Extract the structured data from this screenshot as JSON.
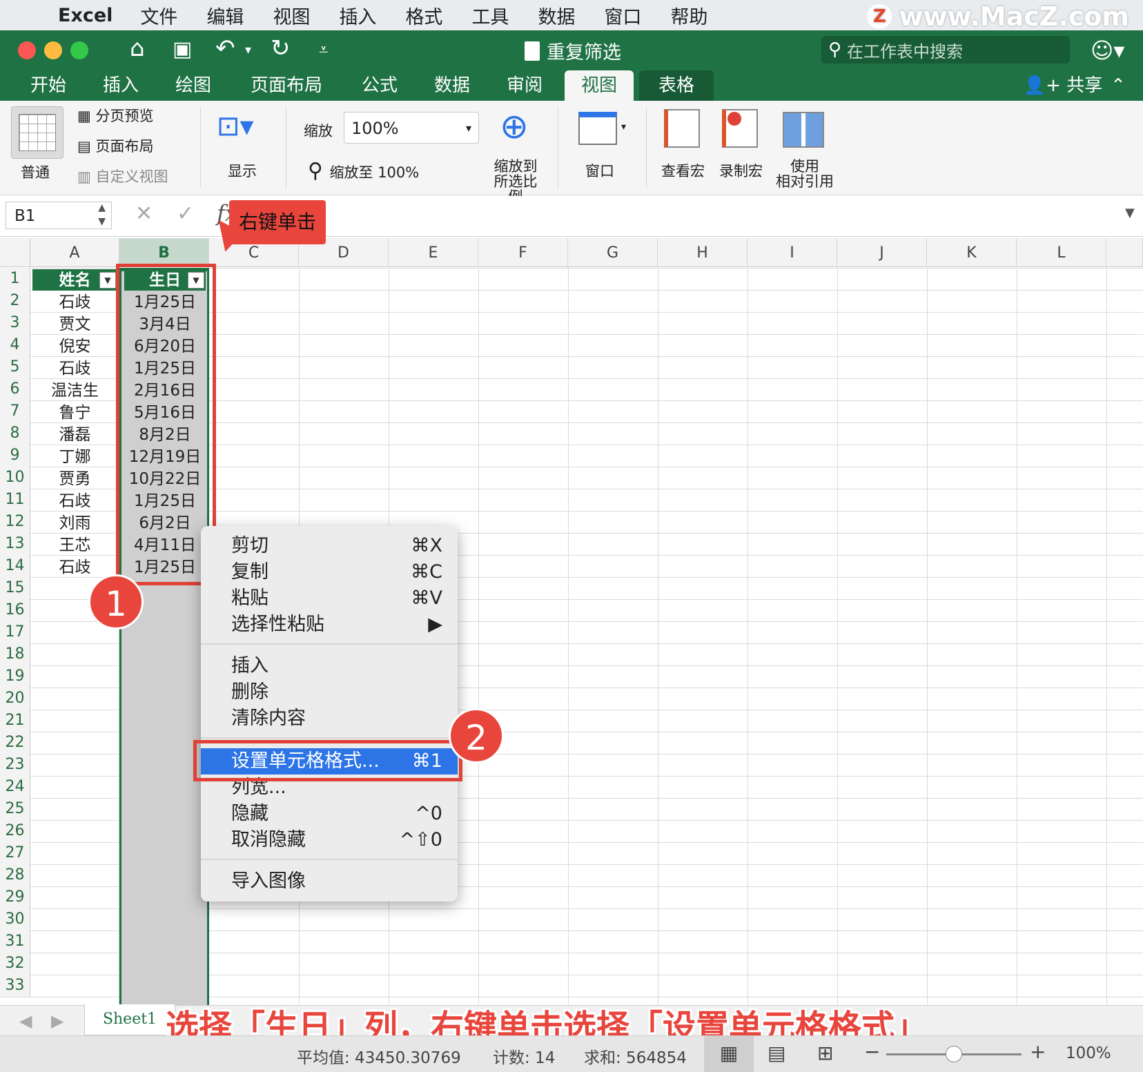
{
  "menubar": {
    "app": "Excel",
    "items": [
      "文件",
      "编辑",
      "视图",
      "插入",
      "格式",
      "工具",
      "数据",
      "窗口",
      "帮助"
    ]
  },
  "watermark": "www.MacZ.com",
  "title": "重复筛选",
  "search_placeholder": "在工作表中搜索",
  "tabs": [
    "开始",
    "插入",
    "绘图",
    "页面布局",
    "公式",
    "数据",
    "审阅",
    "视图",
    "表格"
  ],
  "active_tab": "视图",
  "share_label": "共享",
  "ribbon": {
    "normal": "普通",
    "page_break": "分页预览",
    "page_layout": "页面布局",
    "custom_view": "自定义视图",
    "show": "显示",
    "zoom_label": "缩放",
    "zoom_value": "100%",
    "zoom_100": "缩放至 100%",
    "zoom_sel_1": "缩放到",
    "zoom_sel_2": "所选比例",
    "window": "窗口",
    "view_macro": "查看宏",
    "record_macro": "录制宏",
    "relative_1": "使用",
    "relative_2": "相对引用"
  },
  "formula_bar": {
    "name_box": "B1",
    "fx": "fx"
  },
  "callout_text": "右键单击",
  "columns": [
    "A",
    "B",
    "C",
    "D",
    "E",
    "F",
    "G",
    "H",
    "I",
    "J",
    "K",
    "L"
  ],
  "rows": [
    "1",
    "2",
    "3",
    "4",
    "5",
    "6",
    "7",
    "8",
    "9",
    "10",
    "11",
    "12",
    "13",
    "14",
    "15",
    "16",
    "17",
    "18",
    "19",
    "20",
    "21",
    "22",
    "23",
    "24",
    "25",
    "26",
    "27",
    "28",
    "29",
    "30",
    "31",
    "32",
    "33"
  ],
  "table": {
    "headers": [
      "姓名",
      "生日"
    ],
    "rows": [
      [
        "石歧",
        "1月25日"
      ],
      [
        "贾文",
        "3月4日"
      ],
      [
        "倪安",
        "6月20日"
      ],
      [
        "石歧",
        "1月25日"
      ],
      [
        "温洁生",
        "2月16日"
      ],
      [
        "鲁宁",
        "5月16日"
      ],
      [
        "潘磊",
        "8月2日"
      ],
      [
        "丁娜",
        "12月19日"
      ],
      [
        "贾勇",
        "10月22日"
      ],
      [
        "石歧",
        "1月25日"
      ],
      [
        "刘雨",
        "6月2日"
      ],
      [
        "王芯",
        "4月11日"
      ],
      [
        "石歧",
        "1月25日"
      ]
    ]
  },
  "context_menu": [
    {
      "label": "剪切",
      "shortcut": "⌘X"
    },
    {
      "label": "复制",
      "shortcut": "⌘C"
    },
    {
      "label": "粘贴",
      "shortcut": "⌘V"
    },
    {
      "label": "选择性粘贴",
      "shortcut": "▶"
    },
    {
      "label": "插入",
      "shortcut": ""
    },
    {
      "label": "删除",
      "shortcut": ""
    },
    {
      "label": "清除内容",
      "shortcut": ""
    },
    {
      "label": "设置单元格格式...",
      "shortcut": "⌘1"
    },
    {
      "label": "列宽...",
      "shortcut": ""
    },
    {
      "label": "隐藏",
      "shortcut": "^0"
    },
    {
      "label": "取消隐藏",
      "shortcut": "^⇧0"
    },
    {
      "label": "导入图像",
      "shortcut": ""
    }
  ],
  "badges": [
    "1",
    "2"
  ],
  "sheet_tab": "Sheet1",
  "caption": "选择「生日」列，右键单击选择「设置单元格格式」",
  "status": {
    "average": "平均值: 43450.30769",
    "count": "计数: 14",
    "sum": "求和: 564854",
    "zoom": "100%"
  },
  "colors": {
    "excel_green": "#1f7244",
    "highlight": "#2d74e6",
    "annotation_red": "#e8453c"
  }
}
